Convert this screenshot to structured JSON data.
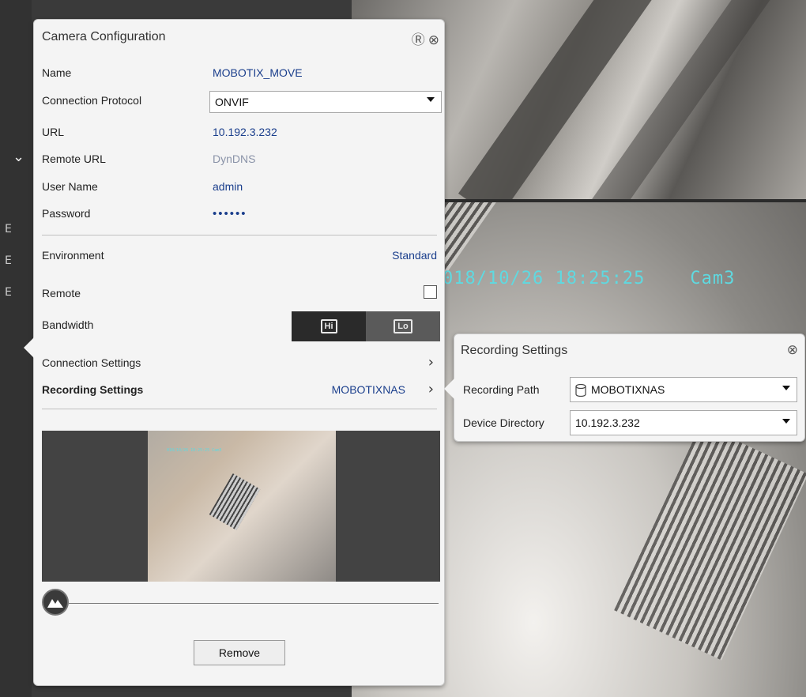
{
  "camera_config": {
    "title": "Camera Configuration",
    "help_icon": "help-circle-icon",
    "close_icon": "close-circle-icon",
    "fields": {
      "name_label": "Name",
      "name_value": "MOBOTIX_MOVE",
      "protocol_label": "Connection Protocol",
      "protocol_value": "ONVIF",
      "url_label": "URL",
      "url_value": "10.192.3.232",
      "remote_url_label": "Remote URL",
      "remote_url_value": "DynDNS",
      "username_label": "User Name",
      "username_value": "admin",
      "password_label": "Password",
      "password_value": "••••••"
    },
    "environment_label": "Environment",
    "environment_value": "Standard",
    "remote_label": "Remote",
    "remote_checked": false,
    "bandwidth_label": "Bandwidth",
    "bandwidth_hi": "Hi",
    "bandwidth_lo": "Lo",
    "bandwidth_selected": "Hi",
    "connection_settings_label": "Connection Settings",
    "recording_settings_label": "Recording Settings",
    "recording_settings_value": "MOBOTIXNAS",
    "remove_label": "Remove"
  },
  "recording_settings": {
    "title": "Recording Settings",
    "recording_path_label": "Recording Path",
    "recording_path_value": "MOBOTIXNAS",
    "device_directory_label": "Device Directory",
    "device_directory_value": "10.192.3.232"
  },
  "video": {
    "osd_text": "018/10/26 18:25:25    Cam3"
  },
  "colors": {
    "link_blue": "#1a3e8c",
    "osd_cyan": "#5fd9e0",
    "panel_bg": "#f4f4f4"
  }
}
